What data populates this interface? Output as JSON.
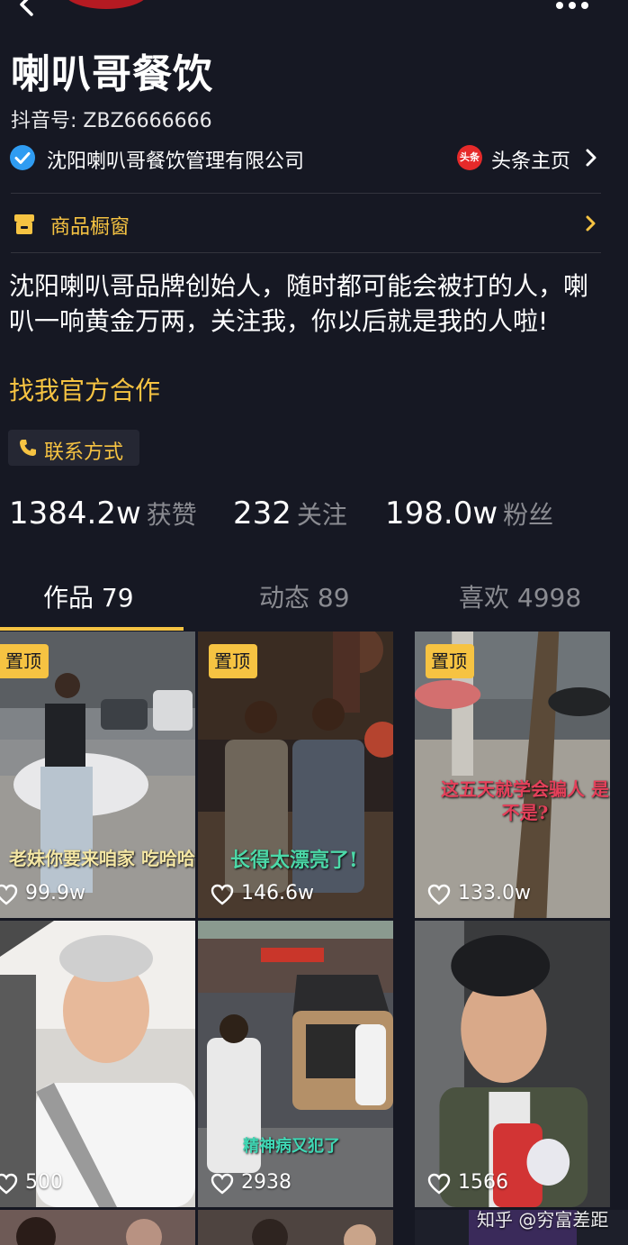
{
  "profile": {
    "name": "喇叭哥餐饮",
    "douyin_id": "抖音号: ZBZ6666666",
    "verified_text": "沈阳喇叭哥餐饮管理有限公司",
    "toutiao_badge": "头条",
    "toutiao_label": "头条主页",
    "shop_label": "商品橱窗",
    "bio": "沈阳喇叭哥品牌创始人，随时都可能会被打的人，喇叭一响黄金万两，关注我，你以后就是我的人啦!",
    "bio_link": "找我官方合作",
    "contact_label": "联系方式"
  },
  "stats": [
    {
      "value": "1384.2w",
      "label": "获赞"
    },
    {
      "value": "232",
      "label": "关注"
    },
    {
      "value": "198.0w",
      "label": "粉丝"
    }
  ],
  "tabs": [
    {
      "label": "作品 79",
      "active": true
    },
    {
      "label": "动态 89",
      "active": false
    },
    {
      "label": "喜欢 4998",
      "active": false
    }
  ],
  "videos": [
    {
      "pinned": "置顶",
      "caption": "老妹你要来咱家 吃哈哈哈便宜。",
      "likes": "99.9w"
    },
    {
      "pinned": "置顶",
      "caption": "长得太漂亮了!",
      "likes": "146.6w"
    },
    {
      "pinned": "置顶",
      "caption": "这五天就学会骗人 是不是?",
      "likes": "133.0w"
    },
    {
      "pinned": "",
      "caption": "",
      "likes": "500"
    },
    {
      "pinned": "",
      "caption": "精神病又犯了",
      "likes": "2938"
    },
    {
      "pinned": "",
      "caption": "",
      "likes": "1566"
    }
  ],
  "watermark": "知乎 @穷富差距",
  "colors": {
    "background": "#161823",
    "accent": "#f6c342",
    "muted": "#8a8b91",
    "verified": "#2f9cf2"
  }
}
